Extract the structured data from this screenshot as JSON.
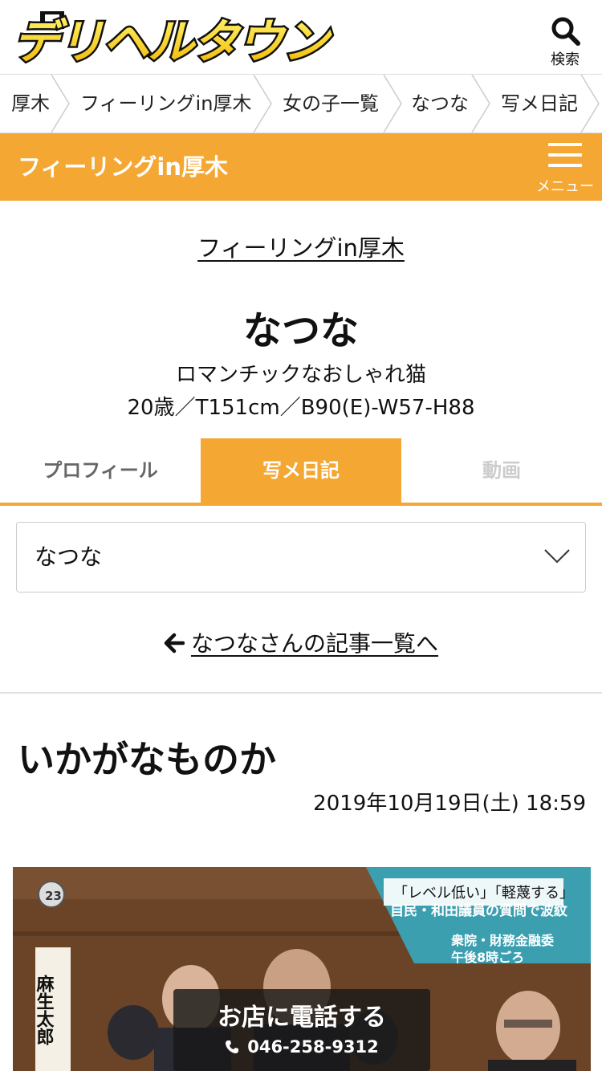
{
  "header": {
    "logo_text": "デリヘルタウン",
    "search_label": "検索"
  },
  "breadcrumb": [
    {
      "label": "厚木"
    },
    {
      "label": "フィーリングin厚木"
    },
    {
      "label": "女の子一覧"
    },
    {
      "label": "なつな"
    },
    {
      "label": "写メ日記"
    }
  ],
  "shop_bar": {
    "shop_name": "フィーリングin厚木",
    "menu_label": "メニュー"
  },
  "profile": {
    "shop_link": "フィーリングin厚木",
    "name": "なつな",
    "catch_copy": "ロマンチックなおしゃれ猫",
    "specs": "20歳／T151cm／B90(E)-W57-H88"
  },
  "tabs": [
    {
      "label": "プロフィール",
      "state": "normal"
    },
    {
      "label": "写メ日記",
      "state": "active"
    },
    {
      "label": "動画",
      "state": "disabled"
    }
  ],
  "girl_select": {
    "value": "なつな"
  },
  "back_link": "なつなさんの記事一覧へ",
  "post": {
    "title": "いかがなものか",
    "date": "2019年10月19日(土) 18:59",
    "photo_caption_1": "「レベル低い」「軽蔑する」",
    "photo_caption_2": "自民・和田議員の質問で波紋",
    "photo_caption_3": "衆院・財務金融委",
    "photo_caption_4": "午後8時ごろ",
    "photo_channel": "23",
    "photo_name_vertical": "麻生太郎"
  },
  "call": {
    "label": "お店に電話する",
    "phone": "046-258-9312"
  },
  "colors": {
    "accent": "#f4a733",
    "text": "#111111"
  }
}
